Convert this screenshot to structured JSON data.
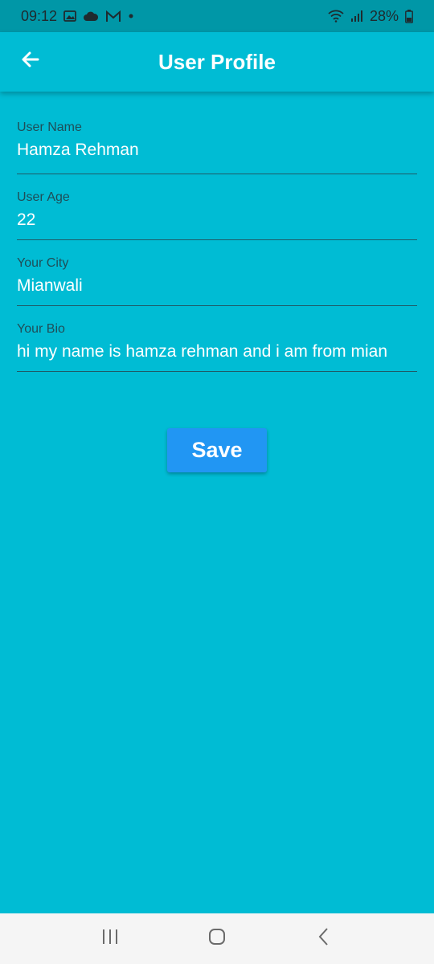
{
  "status_bar": {
    "time": "09:12",
    "battery": "28%",
    "icons": [
      "image-icon",
      "cloud-icon",
      "gmail-icon",
      "dot-icon",
      "wifi-icon",
      "signal-icon",
      "battery-icon"
    ]
  },
  "app_bar": {
    "title": "User Profile",
    "back_icon": "arrow-left-icon"
  },
  "form": {
    "fields": [
      {
        "label": "User Name",
        "value": "Hamza Rehman"
      },
      {
        "label": "User Age",
        "value": "22"
      },
      {
        "label": "Your City",
        "value": "Mianwali"
      },
      {
        "label": "Your Bio",
        "value": "hi my name is hamza rehman and i am from mian"
      }
    ],
    "save_label": "Save"
  },
  "nav_bar": {
    "icons": [
      "recents-icon",
      "home-icon",
      "back-icon"
    ]
  },
  "colors": {
    "background": "#00bcd4",
    "status_bar": "#0097a7",
    "button": "#2196f3",
    "nav_bar": "#f5f5f5"
  }
}
